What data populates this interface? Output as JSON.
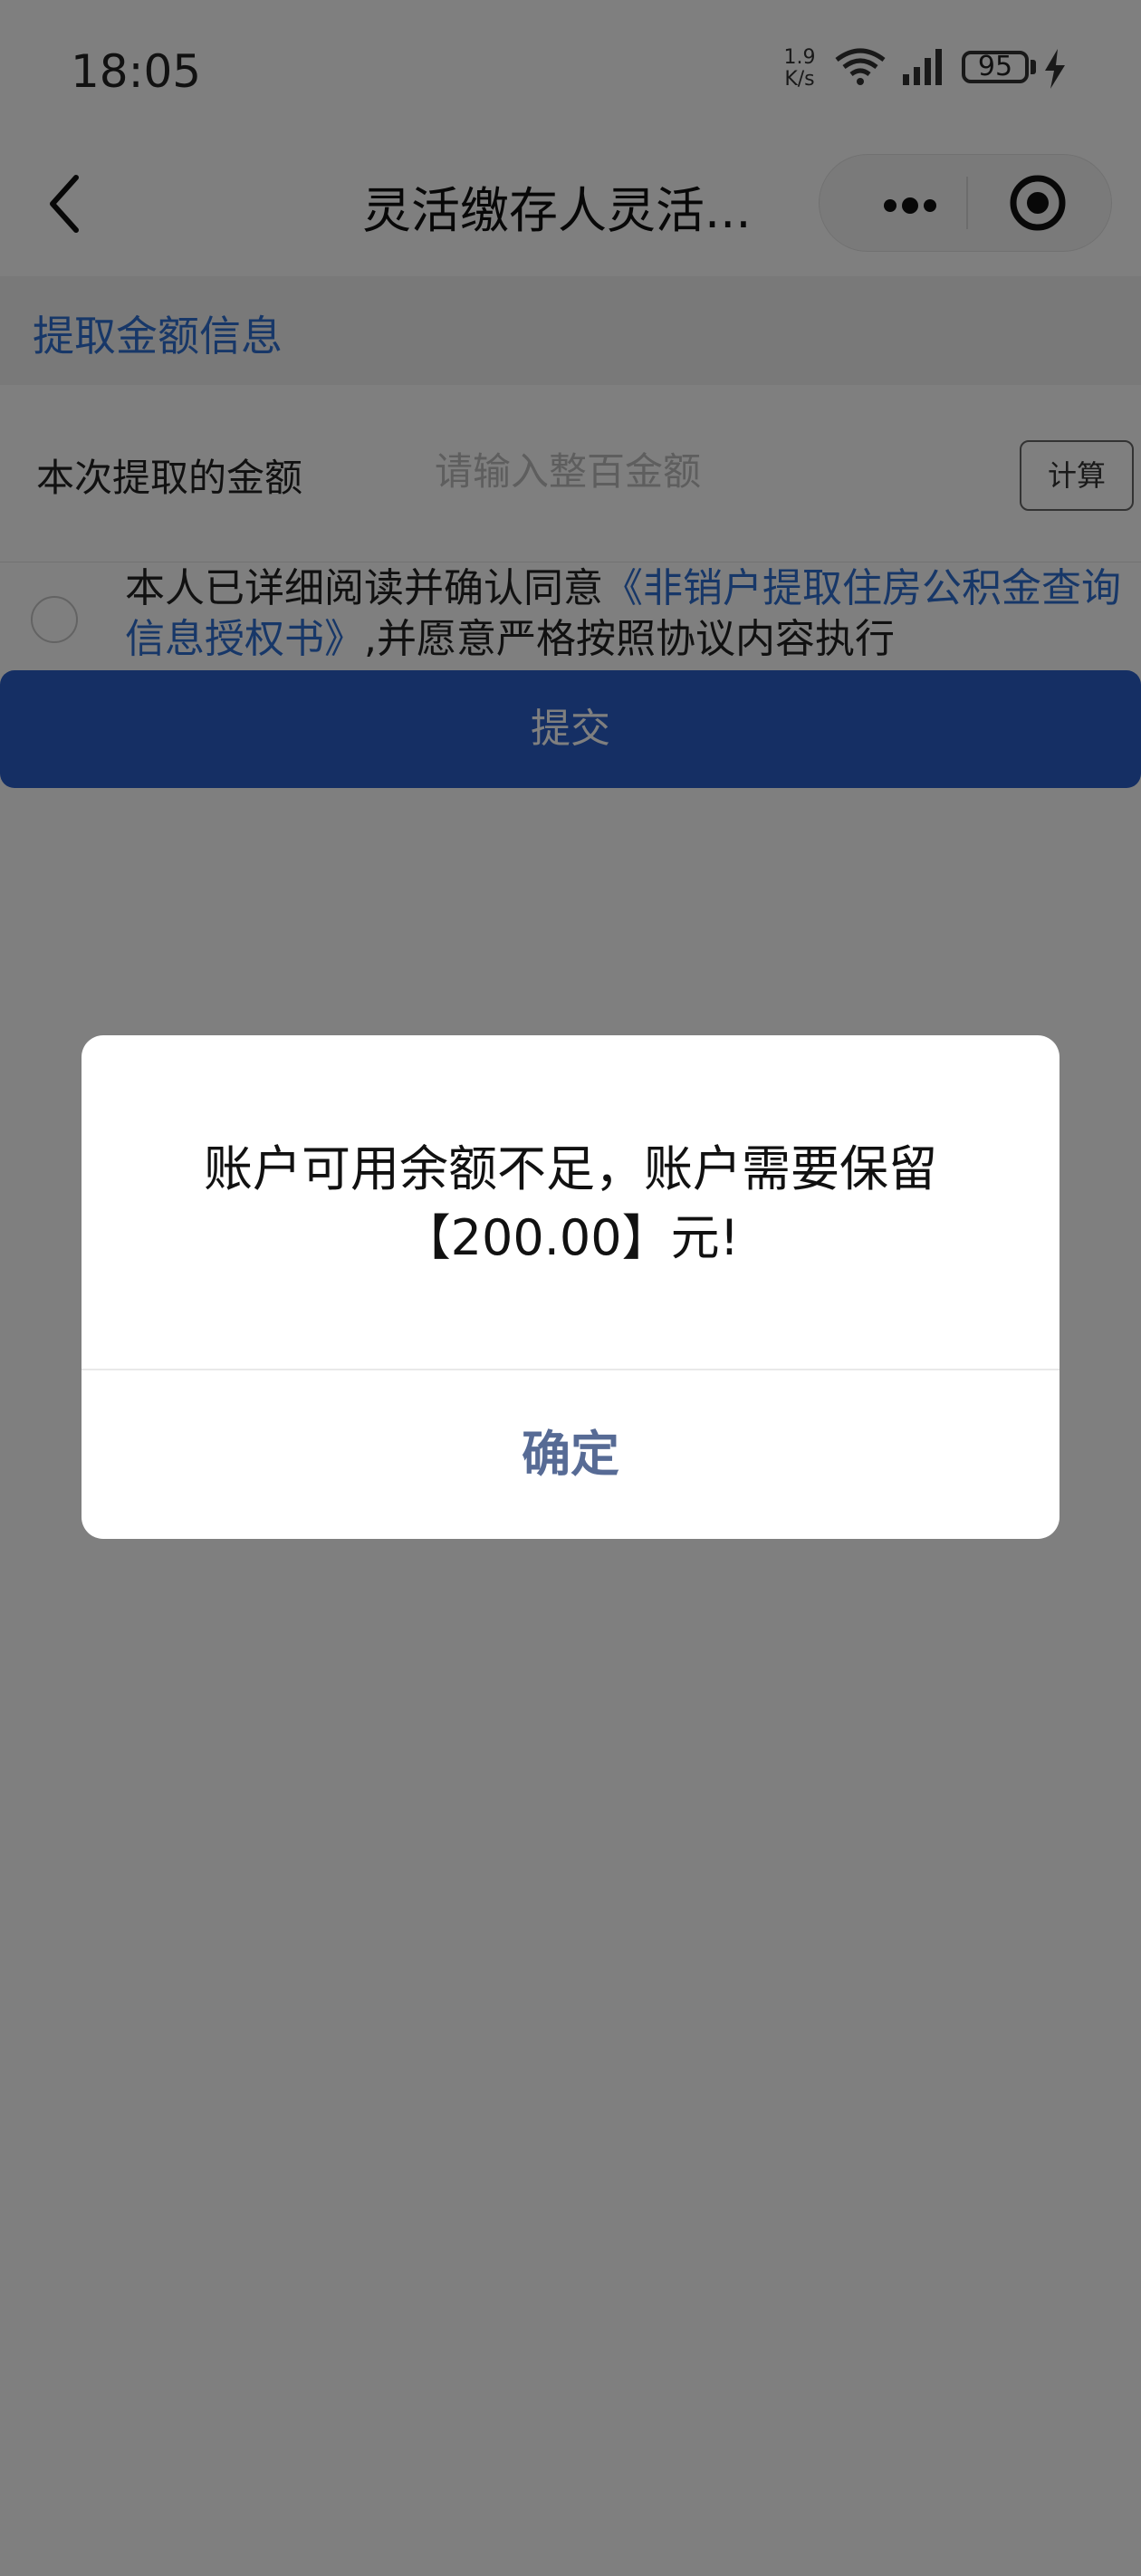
{
  "status_bar": {
    "time": "18:05",
    "net_speed_value": "1.9",
    "net_speed_unit": "K/s",
    "battery": "95",
    "icons": [
      "wifi-icon",
      "signal-icon",
      "battery-icon",
      "charging-icon"
    ]
  },
  "nav": {
    "title": "灵活缴存人灵活...",
    "icons": [
      "back-icon",
      "more-icon",
      "target-icon"
    ]
  },
  "section": {
    "title": "提取金额信息"
  },
  "form": {
    "amount_label": "本次提取的金额",
    "amount_value": "",
    "amount_placeholder": "请输入整百金额",
    "calc_button": "计算"
  },
  "agreement": {
    "text_before": "本人已详细阅读并确认同意",
    "link_text": "《非销户提取住房公积金查询信息授权书》",
    "text_after": ",并愿意严格按照协议内容执行",
    "checked": false
  },
  "submit_button": "提交",
  "modal": {
    "message_line1": "账户可用余额不足，账户需要保留",
    "message_line2": "【200.00】元!",
    "confirm": "确定"
  },
  "colors": {
    "link": "#2f6fd1",
    "submit": "#2a5fc8",
    "confirm": "#576b95"
  }
}
